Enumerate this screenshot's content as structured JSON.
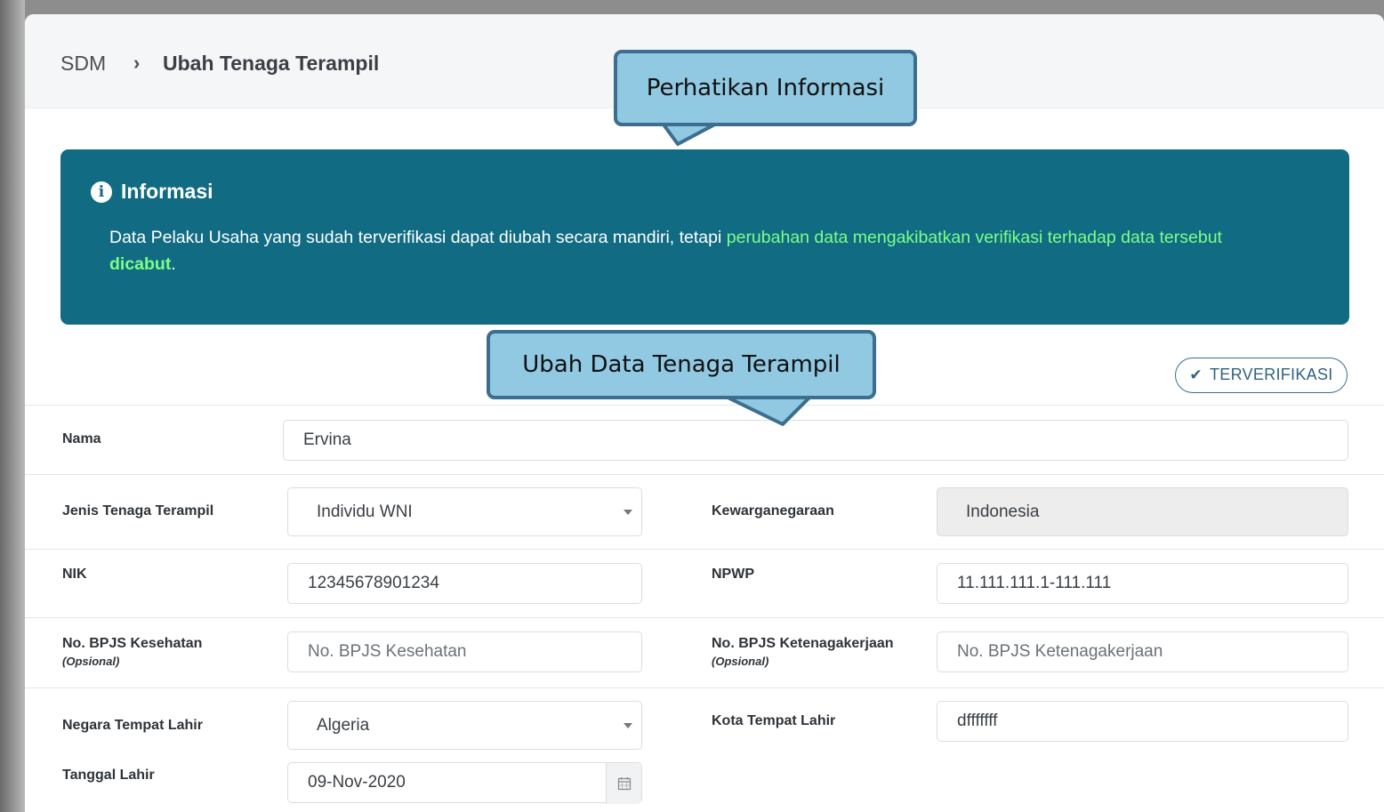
{
  "breadcrumb": {
    "root": "SDM",
    "separator": "›",
    "current": "Ubah Tenaga Terampil"
  },
  "callouts": {
    "info": "Perhatikan Informasi",
    "form": "Ubah Data Tenaga Terampil"
  },
  "info": {
    "title": "Informasi",
    "text_normal": "Data Pelaku Usaha yang sudah terverifikasi dapat diubah secara mandiri, tetapi ",
    "text_highlight": "perubahan data mengakibatkan verifikasi terhadap data tersebut ",
    "text_bold": "dicabut",
    "text_end": "."
  },
  "status": {
    "label": "TERVERIFIKASI",
    "icon": "check-icon"
  },
  "form": {
    "nama": {
      "label": "Nama",
      "value": "Ervina"
    },
    "jenis": {
      "label": "Jenis Tenaga Terampil",
      "value": "Individu WNI"
    },
    "kewarganegaraan": {
      "label": "Kewarganegaraan",
      "value": "Indonesia"
    },
    "nik": {
      "label": "NIK",
      "value": "12345678901234"
    },
    "npwp": {
      "label": "NPWP",
      "value": "11.111.111.1-111.111"
    },
    "bpjs_kes": {
      "label": "No. BPJS Kesehatan",
      "sublabel": "(Opsional)",
      "placeholder": "No. BPJS Kesehatan"
    },
    "bpjs_tk": {
      "label": "No. BPJS Ketenagakerjaan",
      "sublabel": "(Opsional)",
      "placeholder": "No. BPJS Ketenagakerjaan"
    },
    "negara_lahir": {
      "label": "Negara Tempat Lahir",
      "value": "Algeria"
    },
    "kota_lahir": {
      "label": "Kota Tempat Lahir",
      "value": "dfffffff"
    },
    "tanggal_lahir": {
      "label": "Tanggal Lahir",
      "value": "09-Nov-2020"
    }
  },
  "colors": {
    "info_bg": "#116b82",
    "info_highlight": "#7cff87",
    "callout_fill": "#92c9e2",
    "callout_border": "#3b6e8f"
  }
}
